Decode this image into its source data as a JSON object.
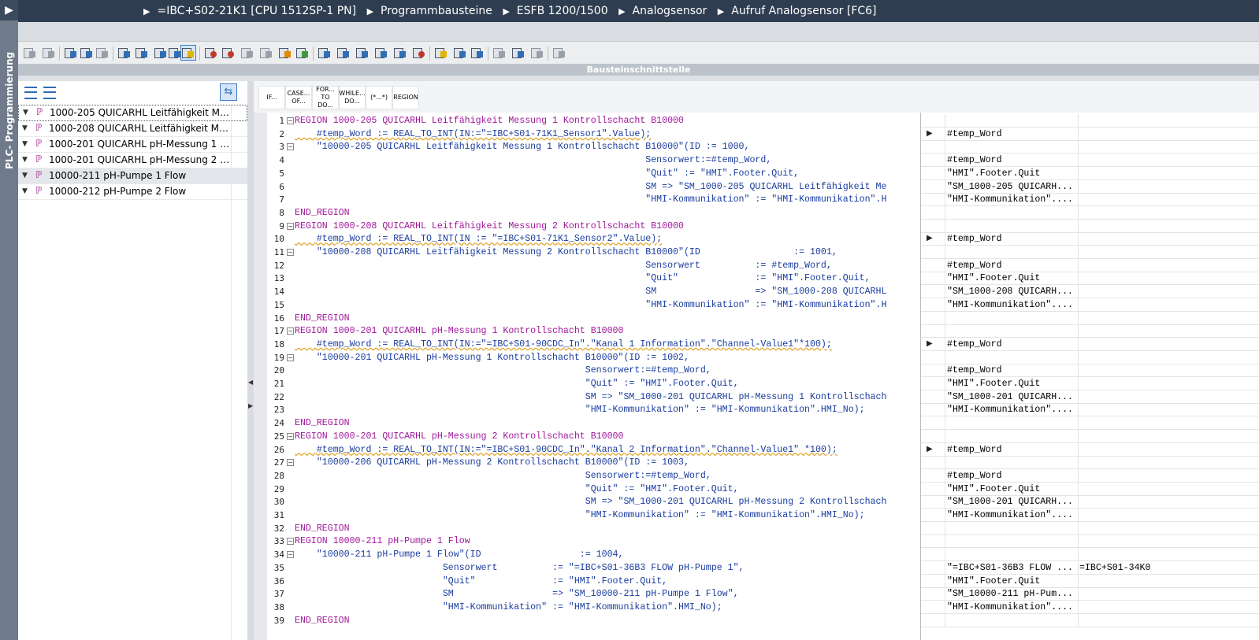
{
  "window": {
    "side_tab_label": "PLC- Programmierung",
    "breadcrumbs": [
      "=IBC+S02-21K1 [CPU 1512SP-1 PN]",
      "Programmbausteine",
      "ESFB 1200/1500",
      "Analogsensor",
      "Aufruf Analogsensor [FC6]"
    ]
  },
  "interface_bar": {
    "label": "Bausteinschnittstelle"
  },
  "snippets": [
    "IF...",
    "CASE... OF...",
    "FOR... TO DO...",
    "WHILE... DO...",
    "(*...*)",
    "REGION"
  ],
  "block_list": [
    {
      "label": "1000-205 QUICARHL Leitfähigkeit Messung 1 Kontrollschacht B10000"
    },
    {
      "label": "1000-208 QUICARHL Leitfähigkeit Messung 2 Kontrollschacht B10000"
    },
    {
      "label": "1000-201 QUICARHL pH-Messung 1 Kontrollschacht B10000"
    },
    {
      "label": "1000-201 QUICARHL pH-Messung 2 Kontrollschacht B10000"
    },
    {
      "label": "10000-211 pH-Pumpe 1 Flow"
    },
    {
      "label": "10000-212 pH-Pumpe 2 Flow"
    }
  ],
  "code_lines": [
    {
      "n": "1",
      "text": "REGION 1000-205 QUICARHL Leitfähigkeit Messung 1 Kontrollschacht B10000",
      "kind": "region"
    },
    {
      "n": "2",
      "text": "    #temp_Word := REAL_TO_INT(IN:=\"=IBC+S01-71K1_Sensor1\".Value);",
      "kind": "assign"
    },
    {
      "n": "3",
      "text": "    \"10000-205 QUICARHL Leitfähigkeit Messung 1 Kontrollschacht B10000\"(ID := 1000,",
      "kind": "call"
    },
    {
      "n": "4",
      "text": "                                                                Sensorwert:=#temp_Word,",
      "kind": "param"
    },
    {
      "n": "5",
      "text": "                                                                \"Quit\" := \"HMI\".Footer.Quit,",
      "kind": "param"
    },
    {
      "n": "6",
      "text": "                                                                SM => \"SM_1000-205 QUICARHL Leitfähigkeit Me",
      "kind": "param"
    },
    {
      "n": "7",
      "text": "                                                                \"HMI-Kommunikation\" := \"HMI-Kommunikation\".H",
      "kind": "param"
    },
    {
      "n": "8",
      "text": "END_REGION",
      "kind": "region"
    },
    {
      "n": "9",
      "text": "REGION 1000-208 QUICARHL Leitfähigkeit Messung 2 Kontrollschacht B10000",
      "kind": "region"
    },
    {
      "n": "10",
      "text": "    #temp_Word := REAL_TO_INT(IN := \"=IBC+S01-71K1_Sensor2\".Value);",
      "kind": "assign"
    },
    {
      "n": "11",
      "text": "    \"10000-208 QUICARHL Leitfähigkeit Messung 2 Kontrollschacht B10000\"(ID                 := 1001,",
      "kind": "call"
    },
    {
      "n": "12",
      "text": "                                                                Sensorwert          := #temp_Word,",
      "kind": "param"
    },
    {
      "n": "13",
      "text": "                                                                \"Quit\"              := \"HMI\".Footer.Quit,",
      "kind": "param"
    },
    {
      "n": "14",
      "text": "                                                                SM                  => \"SM_1000-208 QUICARHL",
      "kind": "param"
    },
    {
      "n": "15",
      "text": "                                                                \"HMI-Kommunikation\" := \"HMI-Kommunikation\".H",
      "kind": "param"
    },
    {
      "n": "16",
      "text": "END_REGION",
      "kind": "region"
    },
    {
      "n": "17",
      "text": "REGION 1000-201 QUICARHL pH-Messung 1 Kontrollschacht B10000",
      "kind": "region"
    },
    {
      "n": "18",
      "text": "    #temp_Word := REAL_TO_INT(IN:=\"=IBC+S01-90CDC_In\".\"Kanal 1 Information\".\"Channel-Value1\"*100);",
      "kind": "assign"
    },
    {
      "n": "19",
      "text": "    \"10000-201 QUICARHL pH-Messung 1 Kontrollschacht B10000\"(ID := 1002,",
      "kind": "call"
    },
    {
      "n": "20",
      "text": "                                                     Sensorwert:=#temp_Word,",
      "kind": "param"
    },
    {
      "n": "21",
      "text": "                                                     \"Quit\" := \"HMI\".Footer.Quit,",
      "kind": "param"
    },
    {
      "n": "22",
      "text": "                                                     SM => \"SM_1000-201 QUICARHL pH-Messung 1 Kontrollschach",
      "kind": "param"
    },
    {
      "n": "23",
      "text": "                                                     \"HMI-Kommunikation\" := \"HMI-Kommunikation\".HMI_No);",
      "kind": "param"
    },
    {
      "n": "24",
      "text": "END_REGION",
      "kind": "region"
    },
    {
      "n": "25",
      "text": "REGION 1000-201 QUICARHL pH-Messung 2 Kontrollschacht B10000",
      "kind": "region"
    },
    {
      "n": "26",
      "text": "    #temp_Word := REAL_TO_INT(IN:=\"=IBC+S01-90CDC_In\".\"Kanal 2 Information\".\"Channel-Value1\" *100);",
      "kind": "assign"
    },
    {
      "n": "27",
      "text": "    \"10000-206 QUICARHL pH-Messung 2 Kontrollschacht B10000\"(ID := 1003,",
      "kind": "call"
    },
    {
      "n": "28",
      "text": "                                                     Sensorwert:=#temp_Word,",
      "kind": "param"
    },
    {
      "n": "29",
      "text": "                                                     \"Quit\" := \"HMI\".Footer.Quit,",
      "kind": "param"
    },
    {
      "n": "30",
      "text": "                                                     SM => \"SM_1000-201 QUICARHL pH-Messung 2 Kontrollschach",
      "kind": "param"
    },
    {
      "n": "31",
      "text": "                                                     \"HMI-Kommunikation\" := \"HMI-Kommunikation\".HMI_No);",
      "kind": "param"
    },
    {
      "n": "32",
      "text": "END_REGION",
      "kind": "region"
    },
    {
      "n": "33",
      "text": "REGION 10000-211 pH-Pumpe 1 Flow",
      "kind": "region"
    },
    {
      "n": "34",
      "text": "    \"10000-211 pH-Pumpe 1 Flow\"(ID                  := 1004,",
      "kind": "call"
    },
    {
      "n": "35",
      "text": "                           Sensorwert          := \"=IBC+S01-36B3 FLOW pH-Pumpe 1\",",
      "kind": "param"
    },
    {
      "n": "36",
      "text": "                           \"Quit\"              := \"HMI\".Footer.Quit,",
      "kind": "param"
    },
    {
      "n": "37",
      "text": "                           SM                  => \"SM_10000-211 pH-Pumpe 1 Flow\",",
      "kind": "param"
    },
    {
      "n": "38",
      "text": "                           \"HMI-Kommunikation\" := \"HMI-Kommunikation\".HMI_No);",
      "kind": "param"
    },
    {
      "n": "39",
      "text": "END_REGION",
      "kind": "region"
    }
  ],
  "watch_rows": [
    {
      "arrow": false,
      "v1": "",
      "v2": ""
    },
    {
      "arrow": true,
      "v1": "#temp_Word",
      "v2": ""
    },
    {
      "arrow": false,
      "v1": "",
      "v2": ""
    },
    {
      "arrow": false,
      "v1": "#temp_Word",
      "v2": ""
    },
    {
      "arrow": false,
      "v1": "\"HMI\".Footer.Quit",
      "v2": ""
    },
    {
      "arrow": false,
      "v1": "\"SM_1000-205 QUICARH...",
      "v2": ""
    },
    {
      "arrow": false,
      "v1": "\"HMI-Kommunikation\"....",
      "v2": ""
    },
    {
      "arrow": false,
      "v1": "",
      "v2": ""
    },
    {
      "arrow": false,
      "v1": "",
      "v2": ""
    },
    {
      "arrow": true,
      "v1": "#temp_Word",
      "v2": ""
    },
    {
      "arrow": false,
      "v1": "",
      "v2": ""
    },
    {
      "arrow": false,
      "v1": "#temp_Word",
      "v2": ""
    },
    {
      "arrow": false,
      "v1": "\"HMI\".Footer.Quit",
      "v2": ""
    },
    {
      "arrow": false,
      "v1": "\"SM_1000-208 QUICARH...",
      "v2": ""
    },
    {
      "arrow": false,
      "v1": "\"HMI-Kommunikation\"....",
      "v2": ""
    },
    {
      "arrow": false,
      "v1": "",
      "v2": ""
    },
    {
      "arrow": false,
      "v1": "",
      "v2": ""
    },
    {
      "arrow": true,
      "v1": "#temp_Word",
      "v2": ""
    },
    {
      "arrow": false,
      "v1": "",
      "v2": ""
    },
    {
      "arrow": false,
      "v1": "#temp_Word",
      "v2": ""
    },
    {
      "arrow": false,
      "v1": "\"HMI\".Footer.Quit",
      "v2": ""
    },
    {
      "arrow": false,
      "v1": "\"SM_1000-201 QUICARH...",
      "v2": ""
    },
    {
      "arrow": false,
      "v1": "\"HMI-Kommunikation\"....",
      "v2": ""
    },
    {
      "arrow": false,
      "v1": "",
      "v2": ""
    },
    {
      "arrow": false,
      "v1": "",
      "v2": ""
    },
    {
      "arrow": true,
      "v1": "#temp_Word",
      "v2": ""
    },
    {
      "arrow": false,
      "v1": "",
      "v2": ""
    },
    {
      "arrow": false,
      "v1": "#temp_Word",
      "v2": ""
    },
    {
      "arrow": false,
      "v1": "\"HMI\".Footer.Quit",
      "v2": ""
    },
    {
      "arrow": false,
      "v1": "\"SM_1000-201 QUICARH...",
      "v2": ""
    },
    {
      "arrow": false,
      "v1": "\"HMI-Kommunikation\"....",
      "v2": ""
    },
    {
      "arrow": false,
      "v1": "",
      "v2": ""
    },
    {
      "arrow": false,
      "v1": "",
      "v2": ""
    },
    {
      "arrow": false,
      "v1": "",
      "v2": ""
    },
    {
      "arrow": false,
      "v1": "\"=IBC+S01-36B3 FLOW ...",
      "v2": "=IBC+S01-34K0"
    },
    {
      "arrow": false,
      "v1": "\"HMI\".Footer.Quit",
      "v2": ""
    },
    {
      "arrow": false,
      "v1": "\"SM_10000-211 pH-Pum...",
      "v2": ""
    },
    {
      "arrow": false,
      "v1": "\"HMI-Kommunikation\"....",
      "v2": ""
    },
    {
      "arrow": false,
      "v1": "",
      "v2": ""
    }
  ],
  "colors": {
    "title_bar": "#2f3d51",
    "side_tab": "#6f7b8a",
    "keyword": "#a0189a",
    "identifier": "#1a3c9e"
  }
}
